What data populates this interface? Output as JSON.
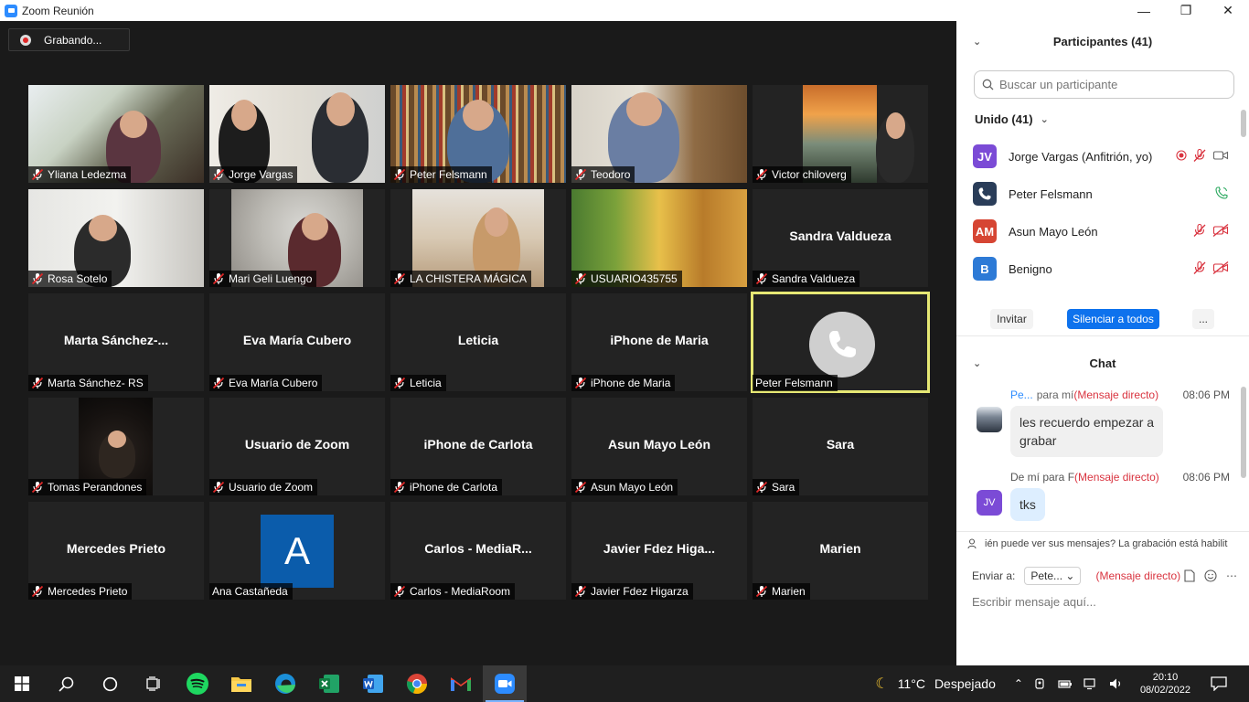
{
  "window": {
    "title": "Zoom Reunión",
    "minimize": "—",
    "maximize": "❐",
    "close": "✕"
  },
  "recording": {
    "label": "Grabando..."
  },
  "tiles": [
    {
      "label": "Yliana Ledezma",
      "muted": true,
      "video": "yliana"
    },
    {
      "label": "Jorge Vargas",
      "muted": true,
      "video": "jorge"
    },
    {
      "label": "Peter Felsmann",
      "muted": true,
      "video": "peter"
    },
    {
      "label": "Teodoro",
      "muted": true,
      "video": "teodoro"
    },
    {
      "label": "Victor chiloverg",
      "muted": true,
      "video": "victor"
    },
    {
      "label": "Rosa Sotelo",
      "muted": true,
      "video": "rosa"
    },
    {
      "label": "Mari Geli Luengo",
      "muted": true,
      "video": "mari"
    },
    {
      "label": "LA CHISTERA MÁGICA",
      "muted": true,
      "video": "chistera"
    },
    {
      "label": "USUARIO435755",
      "muted": true,
      "video": "usuario"
    },
    {
      "label": "Sandra Valdueza",
      "muted": true,
      "center": "Sandra Valdueza"
    },
    {
      "label": "Marta Sánchez- RS",
      "muted": true,
      "center": "Marta  Sánchez-..."
    },
    {
      "label": "Eva María Cubero",
      "muted": true,
      "center": "Eva María Cubero"
    },
    {
      "label": "Leticia",
      "muted": true,
      "center": "Leticia"
    },
    {
      "label": "iPhone de Maria",
      "muted": true,
      "center": "iPhone de Maria"
    },
    {
      "label": "Peter Felsmann",
      "muted": false,
      "phone": true,
      "active": true
    },
    {
      "label": "Tomas Perandones",
      "muted": true,
      "video": "tomas"
    },
    {
      "label": "Usuario de Zoom",
      "muted": true,
      "center": "Usuario de Zoom"
    },
    {
      "label": "iPhone de Carlota",
      "muted": true,
      "center": "iPhone de Carlota"
    },
    {
      "label": "Asun Mayo León",
      "muted": true,
      "center": "Asun Mayo León"
    },
    {
      "label": "Sara",
      "muted": true,
      "center": "Sara"
    },
    {
      "label": "Mercedes Prieto",
      "muted": true,
      "center": "Mercedes Prieto"
    },
    {
      "label": "Ana Castañeda",
      "muted": false,
      "avatar_letter": "A"
    },
    {
      "label": "Carlos - MediaRoom",
      "muted": true,
      "center": "Carlos  -  MediaR..."
    },
    {
      "label": "Javier Fdez Higarza",
      "muted": true,
      "center": "Javier  Fdez  Higa..."
    },
    {
      "label": "Marien",
      "muted": true,
      "center": "Marien"
    }
  ],
  "participants_panel": {
    "title": "Participantes (41)",
    "search_placeholder": "Buscar un participante",
    "group_label": "Unido (41)",
    "participants": [
      {
        "initials": "JV",
        "color": "#7b4bd6",
        "name": "Jorge Vargas (Anfitrión, yo)"
      },
      {
        "initials": "",
        "color": "#2a3d59",
        "name": "Peter Felsmann"
      },
      {
        "initials": "AM",
        "color": "#d64533",
        "name": "Asun Mayo León"
      },
      {
        "initials": "B",
        "color": "#2d7ad6",
        "name": "Benigno"
      }
    ],
    "invite_label": "Invitar",
    "mute_all_label": "Silenciar a todos",
    "more_label": "..."
  },
  "chat": {
    "title": "Chat",
    "messages": [
      {
        "from": "Pe...",
        "to": "para mí",
        "dm": "(Mensaje directo)",
        "time": "08:06 PM",
        "text_line1": "les recuerdo empezar a",
        "text_line2": "grabar"
      },
      {
        "from": "De mí para F",
        "to": "",
        "dm": "(Mensaje directo)",
        "time": "08:06 PM",
        "text_line1": "tks",
        "avatar": "JV"
      }
    ],
    "notice": "ién puede ver sus mensajes? La grabación está habilit",
    "send_to_label": "Enviar a:",
    "send_to_value": "Pete...",
    "send_mode": "(Mensaje directo)",
    "input_placeholder": "Escribir mensaje aquí..."
  },
  "taskbar": {
    "apps": [
      "windows-start",
      "search",
      "cortana",
      "task-view",
      "spotify",
      "file-explorer",
      "edge",
      "excel",
      "word",
      "chrome",
      "gmail",
      "zoom"
    ],
    "temperature": "11°C",
    "weather": "Despejado",
    "time": "20:10",
    "date": "08/02/2022"
  }
}
